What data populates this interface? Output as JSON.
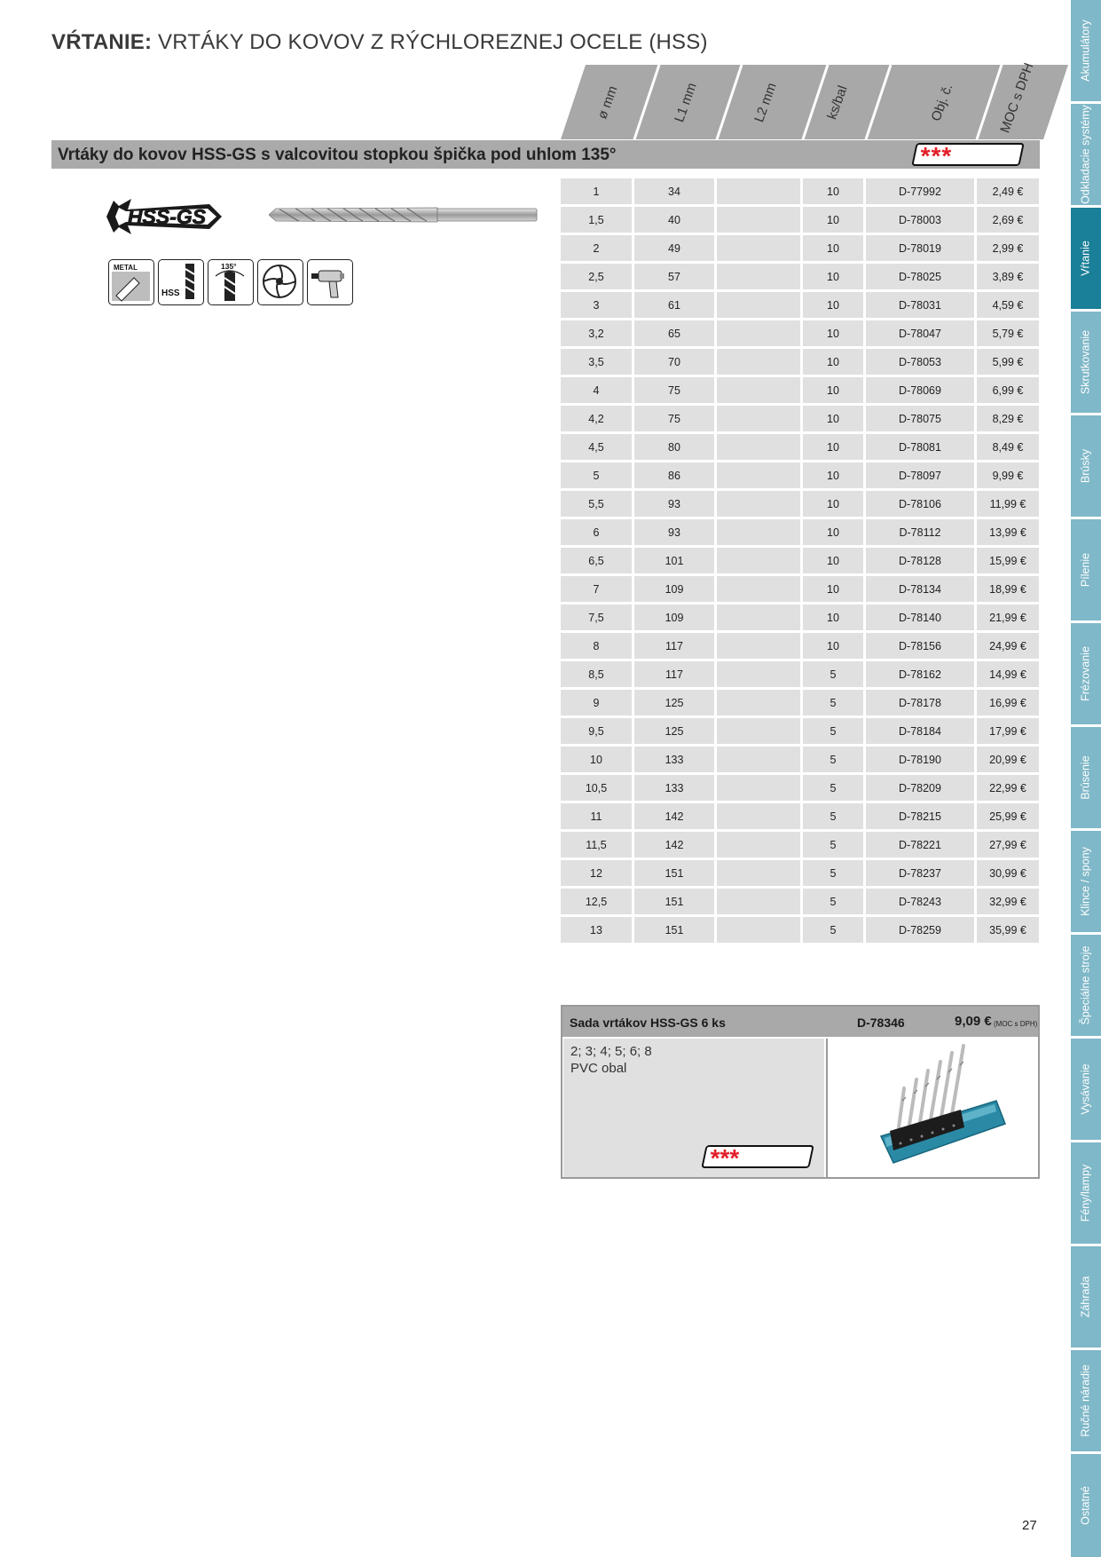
{
  "title": {
    "bold": "VŔTANIE:",
    "rest": "VRTÁKY DO KOVOV Z RÝCHLOREZNEJ OCELE (HSS)"
  },
  "headers": [
    "ø mm",
    "L1 mm",
    "L2 mm",
    "ks/bal",
    "Obj. č.",
    "MOC s DPH"
  ],
  "section": {
    "title": "Vrtáky do kovov HSS-GS s valcovitou stopkou špička pod uhlom 135°",
    "stars": "***"
  },
  "rows": [
    [
      "1",
      "34",
      "",
      "10",
      "D-77992",
      "2,49 €"
    ],
    [
      "1,5",
      "40",
      "",
      "10",
      "D-78003",
      "2,69 €"
    ],
    [
      "2",
      "49",
      "",
      "10",
      "D-78019",
      "2,99 €"
    ],
    [
      "2,5",
      "57",
      "",
      "10",
      "D-78025",
      "3,89 €"
    ],
    [
      "3",
      "61",
      "",
      "10",
      "D-78031",
      "4,59 €"
    ],
    [
      "3,2",
      "65",
      "",
      "10",
      "D-78047",
      "5,79 €"
    ],
    [
      "3,5",
      "70",
      "",
      "10",
      "D-78053",
      "5,99 €"
    ],
    [
      "4",
      "75",
      "",
      "10",
      "D-78069",
      "6,99 €"
    ],
    [
      "4,2",
      "75",
      "",
      "10",
      "D-78075",
      "8,29 €"
    ],
    [
      "4,5",
      "80",
      "",
      "10",
      "D-78081",
      "8,49 €"
    ],
    [
      "5",
      "86",
      "",
      "10",
      "D-78097",
      "9,99 €"
    ],
    [
      "5,5",
      "93",
      "",
      "10",
      "D-78106",
      "11,99 €"
    ],
    [
      "6",
      "93",
      "",
      "10",
      "D-78112",
      "13,99 €"
    ],
    [
      "6,5",
      "101",
      "",
      "10",
      "D-78128",
      "15,99 €"
    ],
    [
      "7",
      "109",
      "",
      "10",
      "D-78134",
      "18,99 €"
    ],
    [
      "7,5",
      "109",
      "",
      "10",
      "D-78140",
      "21,99 €"
    ],
    [
      "8",
      "117",
      "",
      "10",
      "D-78156",
      "24,99 €"
    ],
    [
      "8,5",
      "117",
      "",
      "5",
      "D-78162",
      "14,99 €"
    ],
    [
      "9",
      "125",
      "",
      "5",
      "D-78178",
      "16,99 €"
    ],
    [
      "9,5",
      "125",
      "",
      "5",
      "D-78184",
      "17,99 €"
    ],
    [
      "10",
      "133",
      "",
      "5",
      "D-78190",
      "20,99 €"
    ],
    [
      "10,5",
      "133",
      "",
      "5",
      "D-78209",
      "22,99 €"
    ],
    [
      "11",
      "142",
      "",
      "5",
      "D-78215",
      "25,99 €"
    ],
    [
      "11,5",
      "142",
      "",
      "5",
      "D-78221",
      "27,99 €"
    ],
    [
      "12",
      "151",
      "",
      "5",
      "D-78237",
      "30,99 €"
    ],
    [
      "12,5",
      "151",
      "",
      "5",
      "D-78243",
      "32,99 €"
    ],
    [
      "13",
      "151",
      "",
      "5",
      "D-78259",
      "35,99 €"
    ]
  ],
  "logo": {
    "text": "HSS-GS"
  },
  "icons": [
    {
      "name": "metal-icon",
      "label": "METAL"
    },
    {
      "name": "hss-icon",
      "label": "HSS"
    },
    {
      "name": "angle-135-icon",
      "label": "135°"
    },
    {
      "name": "split-point-icon",
      "label": ""
    },
    {
      "name": "drill-machine-icon",
      "label": ""
    }
  ],
  "set": {
    "name": "Sada vrtákov HSS-GS 6 ks",
    "code": "D-78346",
    "price": "9,09 €",
    "price_note": "(MOC s DPH)",
    "line1": "2; 3; 4; 5; 6; 8",
    "line2": "PVC obal",
    "stars": "***"
  },
  "side_tabs": [
    {
      "label": "Akumulátory",
      "active": false
    },
    {
      "label": "Odkladacie systémy",
      "active": false
    },
    {
      "label": "Vŕtanie",
      "active": true
    },
    {
      "label": "Skrutkovanie",
      "active": false
    },
    {
      "label": "Brúsky",
      "active": false
    },
    {
      "label": "Pílenie",
      "active": false
    },
    {
      "label": "Frézovanie",
      "active": false
    },
    {
      "label": "Brúsenie",
      "active": false
    },
    {
      "label": "Klince / spony",
      "active": false
    },
    {
      "label": "Špeciálne stroje",
      "active": false
    },
    {
      "label": "Vysávanie",
      "active": false
    },
    {
      "label": "Fény/lampy",
      "active": false
    },
    {
      "label": "Záhrada",
      "active": false
    },
    {
      "label": "Ručné náradie",
      "active": false
    },
    {
      "label": "Ostatné",
      "active": false
    }
  ],
  "colors": {
    "tab": "#7fb8c8",
    "tab_active": "#1a7f98",
    "header_gray": "#aaaaaa",
    "cell_gray": "#e0e0e1",
    "stars": "#e3202a"
  },
  "page_number": "27"
}
